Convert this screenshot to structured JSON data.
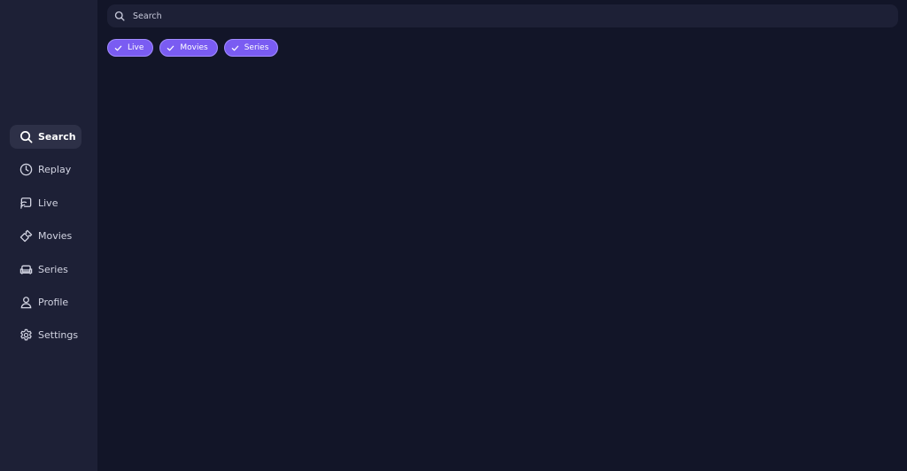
{
  "sidebar": {
    "items": [
      {
        "label": "Search",
        "icon": "search-icon",
        "active": true
      },
      {
        "label": "Replay",
        "icon": "clock-icon",
        "active": false
      },
      {
        "label": "Live",
        "icon": "live-tv-icon",
        "active": false
      },
      {
        "label": "Movies",
        "icon": "ticket-icon",
        "active": false
      },
      {
        "label": "Series",
        "icon": "sofa-icon",
        "active": false
      },
      {
        "label": "Profile",
        "icon": "user-icon",
        "active": false
      },
      {
        "label": "Settings",
        "icon": "gear-icon",
        "active": false
      }
    ]
  },
  "search": {
    "placeholder": "Search",
    "value": ""
  },
  "filters": {
    "chips": [
      {
        "label": "Live",
        "checked": true
      },
      {
        "label": "Movies",
        "checked": true
      },
      {
        "label": "Series",
        "checked": true
      }
    ]
  },
  "colors": {
    "background": "#121528",
    "sidebar": "#1d2036",
    "accent": "#7a5cf2",
    "active_item": "#2d3047"
  }
}
